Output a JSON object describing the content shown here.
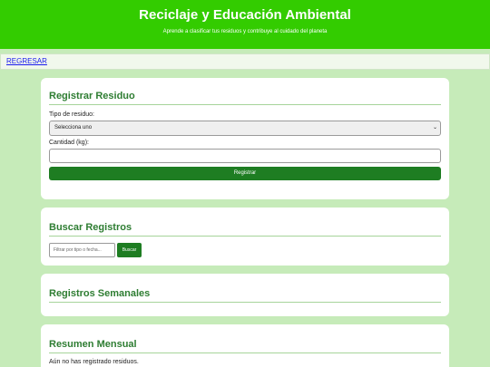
{
  "header": {
    "title": "Reciclaje y Educación Ambiental",
    "subtitle": "Aprende a clasificar tus residuos y contribuye al cuidado del planeta"
  },
  "nav": {
    "back_label": "REGRESAR"
  },
  "register": {
    "title": "Registrar Residuo",
    "type_label": "Tipo de residuo:",
    "type_selected": "Selecciona uno",
    "qty_label": "Cantidad (kg):",
    "qty_value": "",
    "submit_label": "Registrar"
  },
  "search": {
    "title": "Buscar Registros",
    "placeholder": "Filtrar por tipo o fecha...",
    "button_label": "Buscar"
  },
  "weekly": {
    "title": "Registros Semanales"
  },
  "monthly": {
    "title": "Resumen Mensual",
    "empty_text": "Aún no has registrado residuos."
  }
}
